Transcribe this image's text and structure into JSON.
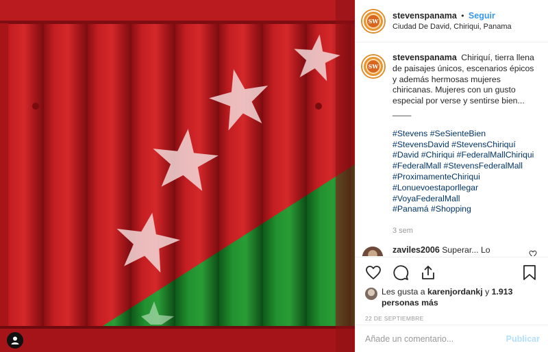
{
  "post": {
    "username": "stevenspanama",
    "separator": "•",
    "follow_label": "Seguir",
    "location": "Ciudad De David, Chiriqui, Panama",
    "avatar_text": "SW",
    "caption_text": "Chiriquí, tierra llena de paisajes únicos, escenarios épicos y además hermosas mujeres chiricanas. Mujeres con un gusto especial por verse y sentirse bien... ____",
    "hashtag_lines": [
      "#Stevens #SeSienteBien",
      "#StevensDavid #StevensChiriquí",
      "#David #Chiriqui #FederalMallChiriqui",
      "#FederalMall #StevensFederalMall",
      "#ProximamenteChiriqui",
      "#Lonuevoestaporllegar",
      "#VoyaFederalMall",
      "#Panamá #Shopping"
    ],
    "caption_time": "3 sem"
  },
  "comments": [
    {
      "username": "zaviles2006",
      "text": "Superar... Lo necesitábamos... Esperamos"
    }
  ],
  "likes": {
    "prefix": "Les gusta a",
    "user": "karenjordankj",
    "joiner": "y",
    "others": "1.913 personas más"
  },
  "date": "22 DE SEPTIEMBRE",
  "add_comment": {
    "placeholder": "Añade un comentario...",
    "publish_label": "Publicar"
  },
  "colors": {
    "accent_blue": "#3897f0",
    "publish_disabled": "#b2dffc",
    "container_red": "#b3161b",
    "flag_green": "#1f8a2c"
  },
  "icons": [
    "user-tag-icon",
    "heart-icon",
    "comment-icon",
    "share-icon",
    "bookmark-icon",
    "small-heart-icon"
  ]
}
